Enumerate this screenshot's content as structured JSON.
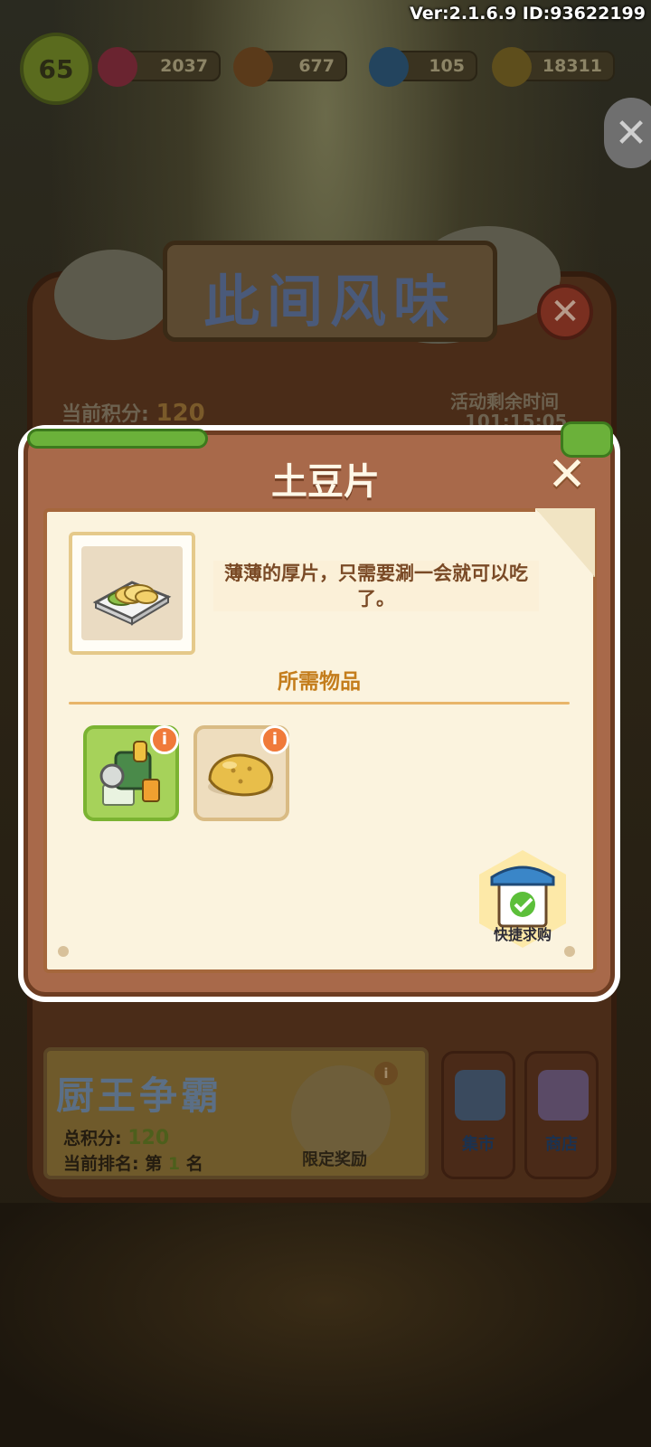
{
  "status": {
    "version_text": "Ver:2.1.6.9 ID:93622199",
    "level": "65",
    "gems": "2037",
    "carrots": "677",
    "energy": "105",
    "coins": "18311"
  },
  "event": {
    "banner_title": "此间风味",
    "current_score_label": "当前积分:",
    "current_score_value": "120",
    "time_left_label": "活动剩余时间",
    "time_left_value": "101:15:05",
    "contest_title": "厨王争霸",
    "total_score_label": "总积分:",
    "total_score_value": "120",
    "rank_label": "当前排名:",
    "rank_prefix": "第",
    "rank_value": "1",
    "rank_suffix": "名",
    "limited_reward_label": "限定奖励",
    "market_label": "集市",
    "shop_label": "商店"
  },
  "dialog": {
    "title": "土豆片",
    "item_name": "土豆片",
    "item_icon": "potato-chips-plate-icon",
    "description": "薄薄的厚片，只需要涮一会就可以吃了。",
    "required_title": "所需物品",
    "required_items": [
      {
        "icon": "slicer-machine-icon",
        "info_badge": "i"
      },
      {
        "icon": "potato-icon",
        "info_badge": "i"
      }
    ],
    "quick_buy_label": "快捷求购"
  },
  "colors": {
    "dialog_wood": "#a8694a",
    "paper": "#fbf3de",
    "accent_orange": "#f07a3a",
    "green_slot": "#a6d25a"
  }
}
